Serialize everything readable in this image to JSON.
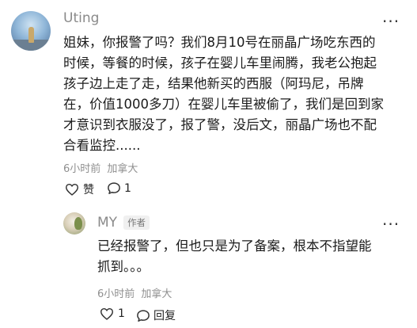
{
  "comment": {
    "username": "Uting",
    "text": "姐妹，你报警了吗？我们8月10号在丽晶广场吃东西的时候，等餐的时候，孩子在婴儿车里闹腾，我老公抱起孩子边上走了走，结果他新买的西服（阿玛尼，吊牌在，价值1000多刀）在婴儿车里被偷了，我们是回到家才意识到衣服没了，报了警，没后文，丽晶广场也不配合看监控......",
    "lines": [
      "姐妹，你报警了吗？我们8月10号在丽晶广场吃东西的",
      "时候，等餐的时候，孩子在婴儿车里闹腾，我老公抱起",
      "孩子边上走了走，结果他新买的西服（阿玛尼，吊牌",
      "在，价值1000多刀）在婴儿车里被偷了，我们是回到家",
      "才意识到衣服没了，报了警，没后文，丽晶广场也不配",
      "合看监控......"
    ],
    "time": "6小时前",
    "location": "加拿大",
    "like_label": "赞",
    "reply_count": "1",
    "more_icon": "···"
  },
  "reply": {
    "username": "MY",
    "badge": "作者",
    "lines": [
      "已经报警了，但也只是为了备案，根本不指望能",
      "抓到。。。"
    ],
    "time": "6小时前",
    "location": "加拿大",
    "like_count": "1",
    "reply_label": "回复",
    "more_icon": "···"
  }
}
